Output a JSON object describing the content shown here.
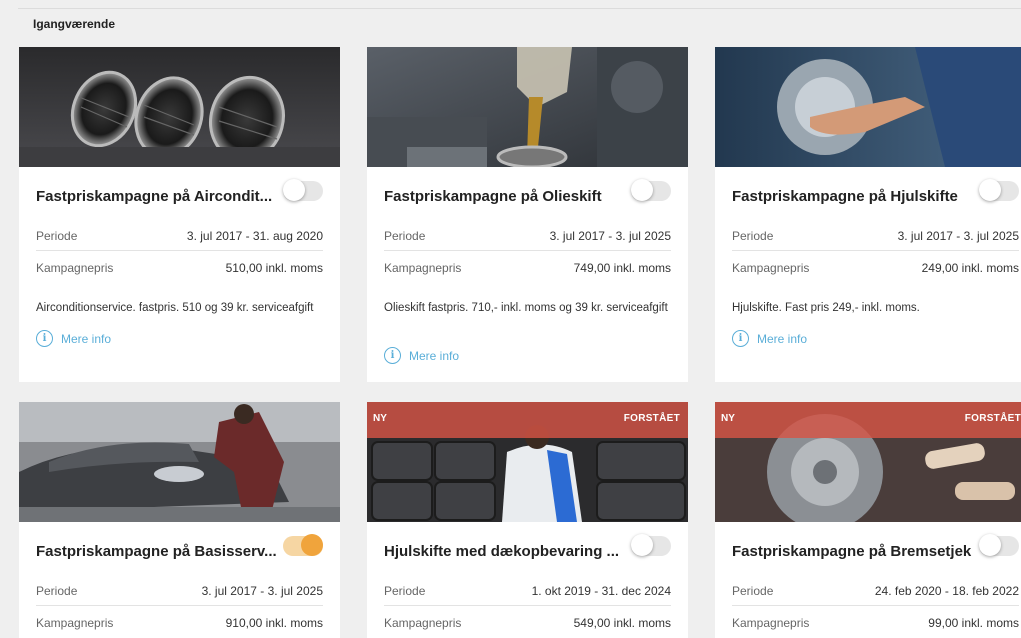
{
  "section": {
    "title": "Igangværende"
  },
  "labels": {
    "periode": "Periode",
    "kampagnepris": "Kampagnepris",
    "more_info": "Mere info",
    "new_tag": "NY",
    "understood_tag": "FORSTÅET"
  },
  "cards": [
    {
      "title": "Fastpriskampagne på Aircondit...",
      "periode": "3. jul 2017 - 31. aug 2020",
      "pris": "510,00 inkl. moms",
      "description": "Airconditionservice. fastpris. 510 og 39 kr. serviceafgift",
      "toggle_on": false,
      "image": "car-air-vents"
    },
    {
      "title": "Fastpriskampagne på Olieskift",
      "periode": "3. jul 2017 - 3. jul 2025",
      "pris": "749,00 inkl. moms",
      "description": "Olieskift fastpris. 710,- inkl. moms og 39 kr. serviceafgift",
      "toggle_on": false,
      "image": "oil-pouring-engine"
    },
    {
      "title": "Fastpriskampagne på Hjulskifte",
      "periode": "3. jul 2017 - 3. jul 2025",
      "pris": "249,00 inkl. moms",
      "description": "Hjulskifte. Fast pris 249,- inkl. moms.",
      "toggle_on": false,
      "image": "wheel-change"
    },
    {
      "title": "Fastpriskampagne på Basisserv...",
      "periode": "3. jul 2017 - 3. jul 2025",
      "pris": "910,00 inkl. moms",
      "toggle_on": true,
      "image": "mechanic-car-hood"
    },
    {
      "title": "Hjulskifte med dækopbevaring ...",
      "periode": "1. okt 2019 - 31. dec 2024",
      "pris": "549,00 inkl. moms",
      "toggle_on": false,
      "image": "tire-storage"
    },
    {
      "title": "Fastpriskampagne på Bremsetjek",
      "periode": "24. feb 2020 - 18. feb 2022",
      "pris": "99,00 inkl. moms",
      "toggle_on": false,
      "image": "brake-disc"
    }
  ],
  "colors": {
    "accent": "#5aaed8",
    "toggle_on": "#f0a43c",
    "tag": "#d65446"
  }
}
